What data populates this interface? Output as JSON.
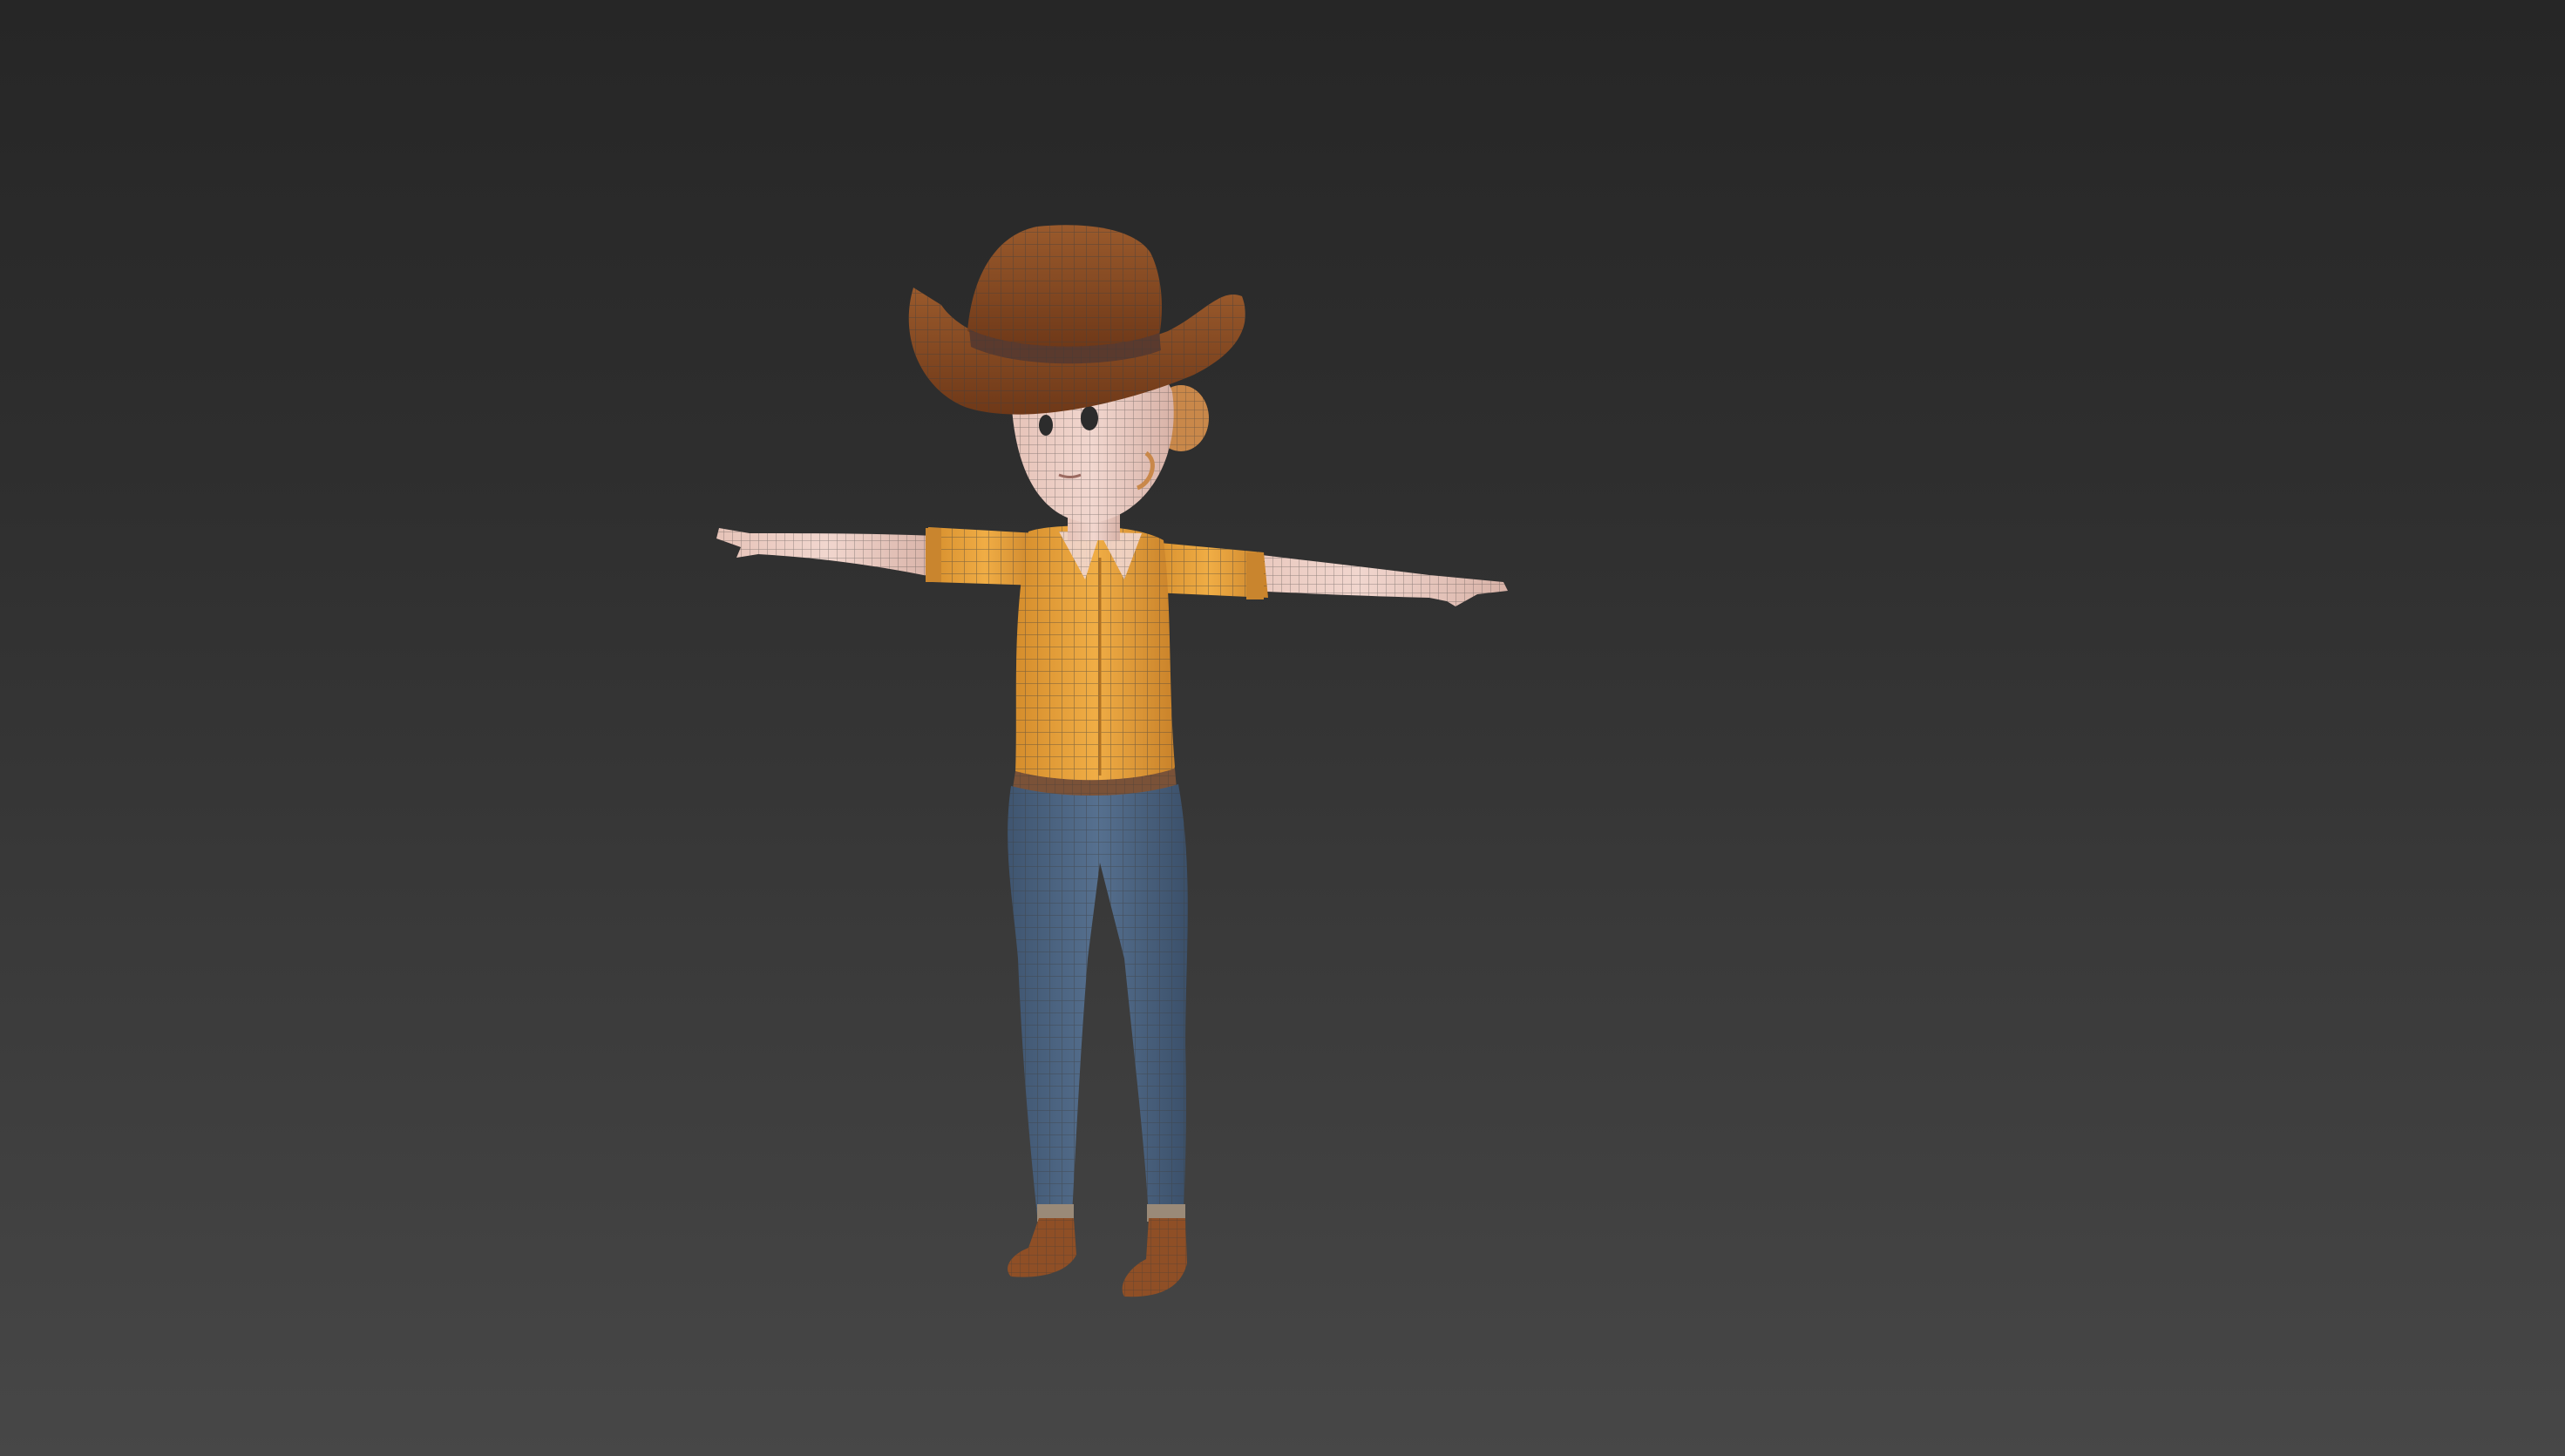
{
  "viewport": {
    "background_top": "#262626",
    "background_bottom": "#474747"
  },
  "model": {
    "pose": "T-pose",
    "display": "wireframe-on-shaded",
    "colors": {
      "hat": "#8a4a22",
      "hat_band": "#5a3a2e",
      "skin": "#e9c9c0",
      "hair": "#c9884a",
      "shirt": "#e7a23a",
      "jeans": "#4a627f",
      "belt": "#7a5238",
      "boots": "#8f4f26",
      "wire": "#3d3d3d"
    }
  }
}
